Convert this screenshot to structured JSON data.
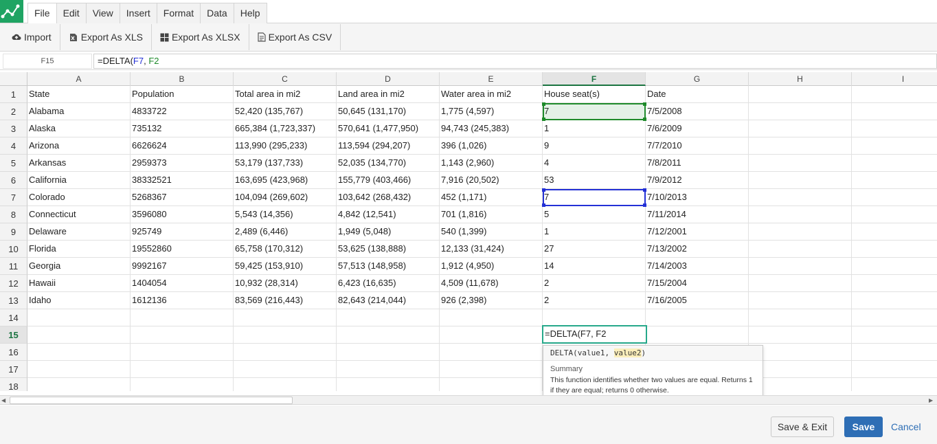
{
  "menu": {
    "tabs": [
      "File",
      "Edit",
      "View",
      "Insert",
      "Format",
      "Data",
      "Help"
    ],
    "active": "File"
  },
  "toolbar": {
    "import_label": "Import",
    "export_xls_label": "Export As XLS",
    "export_xlsx_label": "Export As XLSX",
    "export_csv_label": "Export As CSV"
  },
  "formula_bar": {
    "cell_ref": "F15",
    "formula_prefix": "=DELTA(",
    "ref1": "F7",
    "separator": ", ",
    "ref2": "F2"
  },
  "grid": {
    "columns": [
      "A",
      "B",
      "C",
      "D",
      "E",
      "F",
      "G",
      "H",
      "I"
    ],
    "selected_column": "F",
    "row_numbers": [
      "1",
      "2",
      "3",
      "4",
      "5",
      "6",
      "7",
      "8",
      "9",
      "10",
      "11",
      "12",
      "13",
      "14",
      "15",
      "16",
      "17",
      "18"
    ],
    "selected_row": "15",
    "rows": [
      [
        "State",
        "Population",
        "Total area in mi2",
        "Land area in mi2",
        "Water area in mi2",
        "House seat(s)",
        "Date"
      ],
      [
        "Alabama",
        "4833722",
        "52,420 (135,767)",
        "50,645 (131,170)",
        "1,775 (4,597)",
        "7",
        "7/5/2008"
      ],
      [
        "Alaska",
        "735132",
        "665,384 (1,723,337)",
        "570,641 (1,477,950)",
        "94,743 (245,383)",
        "1",
        "7/6/2009"
      ],
      [
        "Arizona",
        "6626624",
        "113,990 (295,233)",
        "113,594 (294,207)",
        "396 (1,026)",
        "9",
        "7/7/2010"
      ],
      [
        "Arkansas",
        "2959373",
        "53,179 (137,733)",
        "52,035 (134,770)",
        "1,143 (2,960)",
        "4",
        "7/8/2011"
      ],
      [
        "California",
        "38332521",
        "163,695 (423,968)",
        "155,779 (403,466)",
        "7,916 (20,502)",
        "53",
        "7/9/2012"
      ],
      [
        "Colorado",
        "5268367",
        "104,094 (269,602)",
        "103,642 (268,432)",
        "452 (1,171)",
        "7",
        "7/10/2013"
      ],
      [
        "Connecticut",
        "3596080",
        "5,543 (14,356)",
        "4,842 (12,541)",
        "701 (1,816)",
        "5",
        "7/11/2014"
      ],
      [
        "Delaware",
        "925749",
        "2,489 (6,446)",
        "1,949 (5,048)",
        "540 (1,399)",
        "1",
        "7/12/2001"
      ],
      [
        "Florida",
        "19552860",
        "65,758 (170,312)",
        "53,625 (138,888)",
        "12,133 (31,424)",
        "27",
        "7/13/2002"
      ],
      [
        "Georgia",
        "9992167",
        "59,425 (153,910)",
        "57,513 (148,958)",
        "1,912 (4,950)",
        "14",
        "7/14/2003"
      ],
      [
        "Hawaii",
        "1404054",
        "10,932 (28,314)",
        "6,423 (16,635)",
        "4,509 (11,678)",
        "2",
        "7/15/2004"
      ],
      [
        "Idaho",
        "1612136",
        "83,569 (216,443)",
        "82,643 (214,044)",
        "926 (2,398)",
        "2",
        "7/16/2005"
      ]
    ],
    "editor_text": "=DELTA(F7, F2"
  },
  "tooltip": {
    "sig_fn": "DELTA(",
    "sig_param1": "value1",
    "sig_sep": ", ",
    "sig_param2": "value2",
    "sig_close": ")",
    "summary_title": "Summary",
    "summary": "This function identifies whether two values are equal. Returns 1 if they are equal; returns 0 otherwise."
  },
  "footer": {
    "save_exit_label": "Save & Exit",
    "save_label": "Save",
    "cancel_label": "Cancel"
  },
  "colors": {
    "logo": "#1fa463",
    "ref_blue": "#2330d6",
    "ref_green": "#1e8a2a",
    "save_button": "#2e6eb5",
    "editor_border": "#26a88a"
  },
  "icons": {
    "logo": "spreadsheet-chart-icon",
    "import": "cloud-upload-icon",
    "export_xls": "xls-file-icon",
    "export_xlsx": "windows-icon",
    "export_csv": "document-icon"
  }
}
